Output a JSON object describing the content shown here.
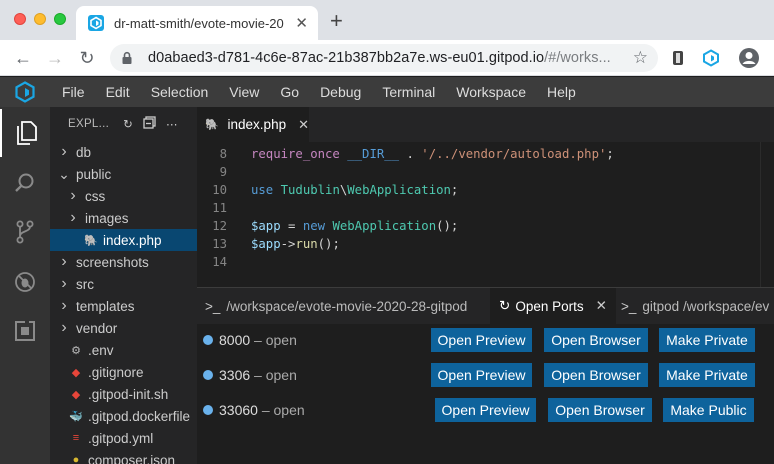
{
  "browser": {
    "tab_title": "dr-matt-smith/evote-movie-20",
    "new_tab_label": "+",
    "url_host": "d0abaed3-d781-4c6e-87ac-21b387bb2a7e.ws-eu01.gitpod.io",
    "url_path": "/#/works..."
  },
  "menu": [
    "File",
    "Edit",
    "Selection",
    "View",
    "Go",
    "Debug",
    "Terminal",
    "Workspace",
    "Help"
  ],
  "sidebar": {
    "title": "EXPL...",
    "items": [
      {
        "label": "db",
        "kind": "folder",
        "chev": "›"
      },
      {
        "label": "public",
        "kind": "folder",
        "chev": "⌄"
      },
      {
        "label": "css",
        "kind": "folder",
        "chev": "›"
      },
      {
        "label": "images",
        "kind": "folder",
        "chev": "›"
      },
      {
        "label": "index.php",
        "kind": "php"
      },
      {
        "label": "screenshots",
        "kind": "folder",
        "chev": "›"
      },
      {
        "label": "src",
        "kind": "folder",
        "chev": "›"
      },
      {
        "label": "templates",
        "kind": "folder",
        "chev": "›"
      },
      {
        "label": "vendor",
        "kind": "folder",
        "chev": "›"
      },
      {
        "label": ".env",
        "kind": "gear"
      },
      {
        "label": ".gitignore",
        "kind": "git"
      },
      {
        "label": ".gitpod-init.sh",
        "kind": "shell"
      },
      {
        "label": ".gitpod.dockerfile",
        "kind": "docker"
      },
      {
        "label": ".gitpod.yml",
        "kind": "yml"
      },
      {
        "label": "composer.json",
        "kind": "json"
      }
    ]
  },
  "editor": {
    "tab_label": "index.php",
    "lines": [
      {
        "n": "8",
        "code": "require_once"
      },
      {
        "n": "9"
      },
      {
        "n": "10"
      },
      {
        "n": "11"
      },
      {
        "n": "12"
      },
      {
        "n": "13"
      },
      {
        "n": "14"
      }
    ],
    "tokens": {
      "require_once": "require_once",
      "dir": "__DIR__",
      "dot": " . ",
      "path": "'/../vendor/autoload.php'",
      "semi": ";",
      "use": "use",
      "ns": "Tudublin",
      "bs": "\\",
      "cls": "WebApplication",
      "app": "$app",
      "eq": " = ",
      "new": "new",
      "parens": "();",
      "arrow": "->",
      "run": "run",
      "runparens": "();"
    }
  },
  "panel": {
    "tabs": [
      {
        "label": "/workspace/evote-movie-2020-28-gitpod",
        "prefix": ">_"
      },
      {
        "label": "Open Ports",
        "active": true
      },
      {
        "label": "gitpod /workspace/ev",
        "prefix": ">_"
      }
    ],
    "ports": [
      {
        "port": "8000",
        "status": "– open",
        "buttons": [
          "Open Preview",
          "Open Browser",
          "Make Private"
        ]
      },
      {
        "port": "3306",
        "status": "– open",
        "buttons": [
          "Open Preview",
          "Open Browser",
          "Make Private"
        ]
      },
      {
        "port": "33060",
        "status": "– open",
        "buttons": [
          "Open Preview",
          "Open Browser",
          "Make Public"
        ]
      }
    ]
  },
  "colors": {
    "accent": "#0e639c",
    "selection": "#094771",
    "port_dot": "#6ab2ec"
  }
}
